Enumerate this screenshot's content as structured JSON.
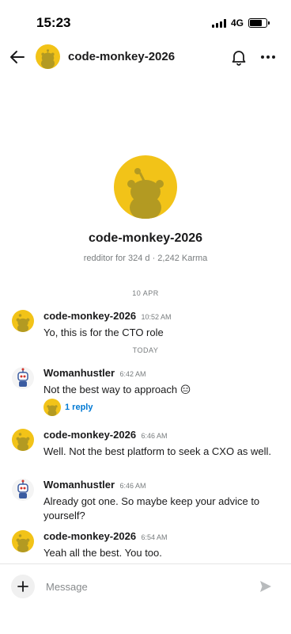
{
  "status_bar": {
    "time": "15:23",
    "network": "4G"
  },
  "header": {
    "title": "code-monkey-2026"
  },
  "profile": {
    "name": "code-monkey-2026",
    "meta": "redditor for 324 d · 2,242 Karma"
  },
  "separators": {
    "first": "10 APR",
    "second": "TODAY"
  },
  "messages": [
    {
      "author": "code-monkey-2026",
      "time": "10:52 AM",
      "text": "Yo, this is for the CTO role",
      "avatar": "snoo-yellow"
    },
    {
      "author": "Womanhustler",
      "time": "6:42 AM",
      "text": "Not the best way to approach 😑",
      "avatar": "robot-avatar"
    },
    {
      "author": "code-monkey-2026",
      "time": "6:46 AM",
      "text": "Well. Not the best platform to seek a CXO as well.",
      "avatar": "snoo-yellow"
    },
    {
      "author": "Womanhustler",
      "time": "6:46 AM",
      "text": "Already got one. So maybe keep your advice to yourself?",
      "avatar": "robot-avatar"
    },
    {
      "author": "code-monkey-2026",
      "time": "6:54 AM",
      "text": "Yeah all the best. You too.",
      "avatar": "snoo-yellow"
    }
  ],
  "reply": {
    "label": "1 reply"
  },
  "composer": {
    "placeholder": "Message"
  },
  "icons": {
    "back": "arrow-left-icon",
    "bell": "bell-icon",
    "more": "more-horizontal-icon",
    "plus": "plus-icon",
    "send": "send-icon"
  },
  "colors": {
    "accent": "#0079d3",
    "avatar_yellow": "#f2c318",
    "muted": "#787c7e"
  }
}
